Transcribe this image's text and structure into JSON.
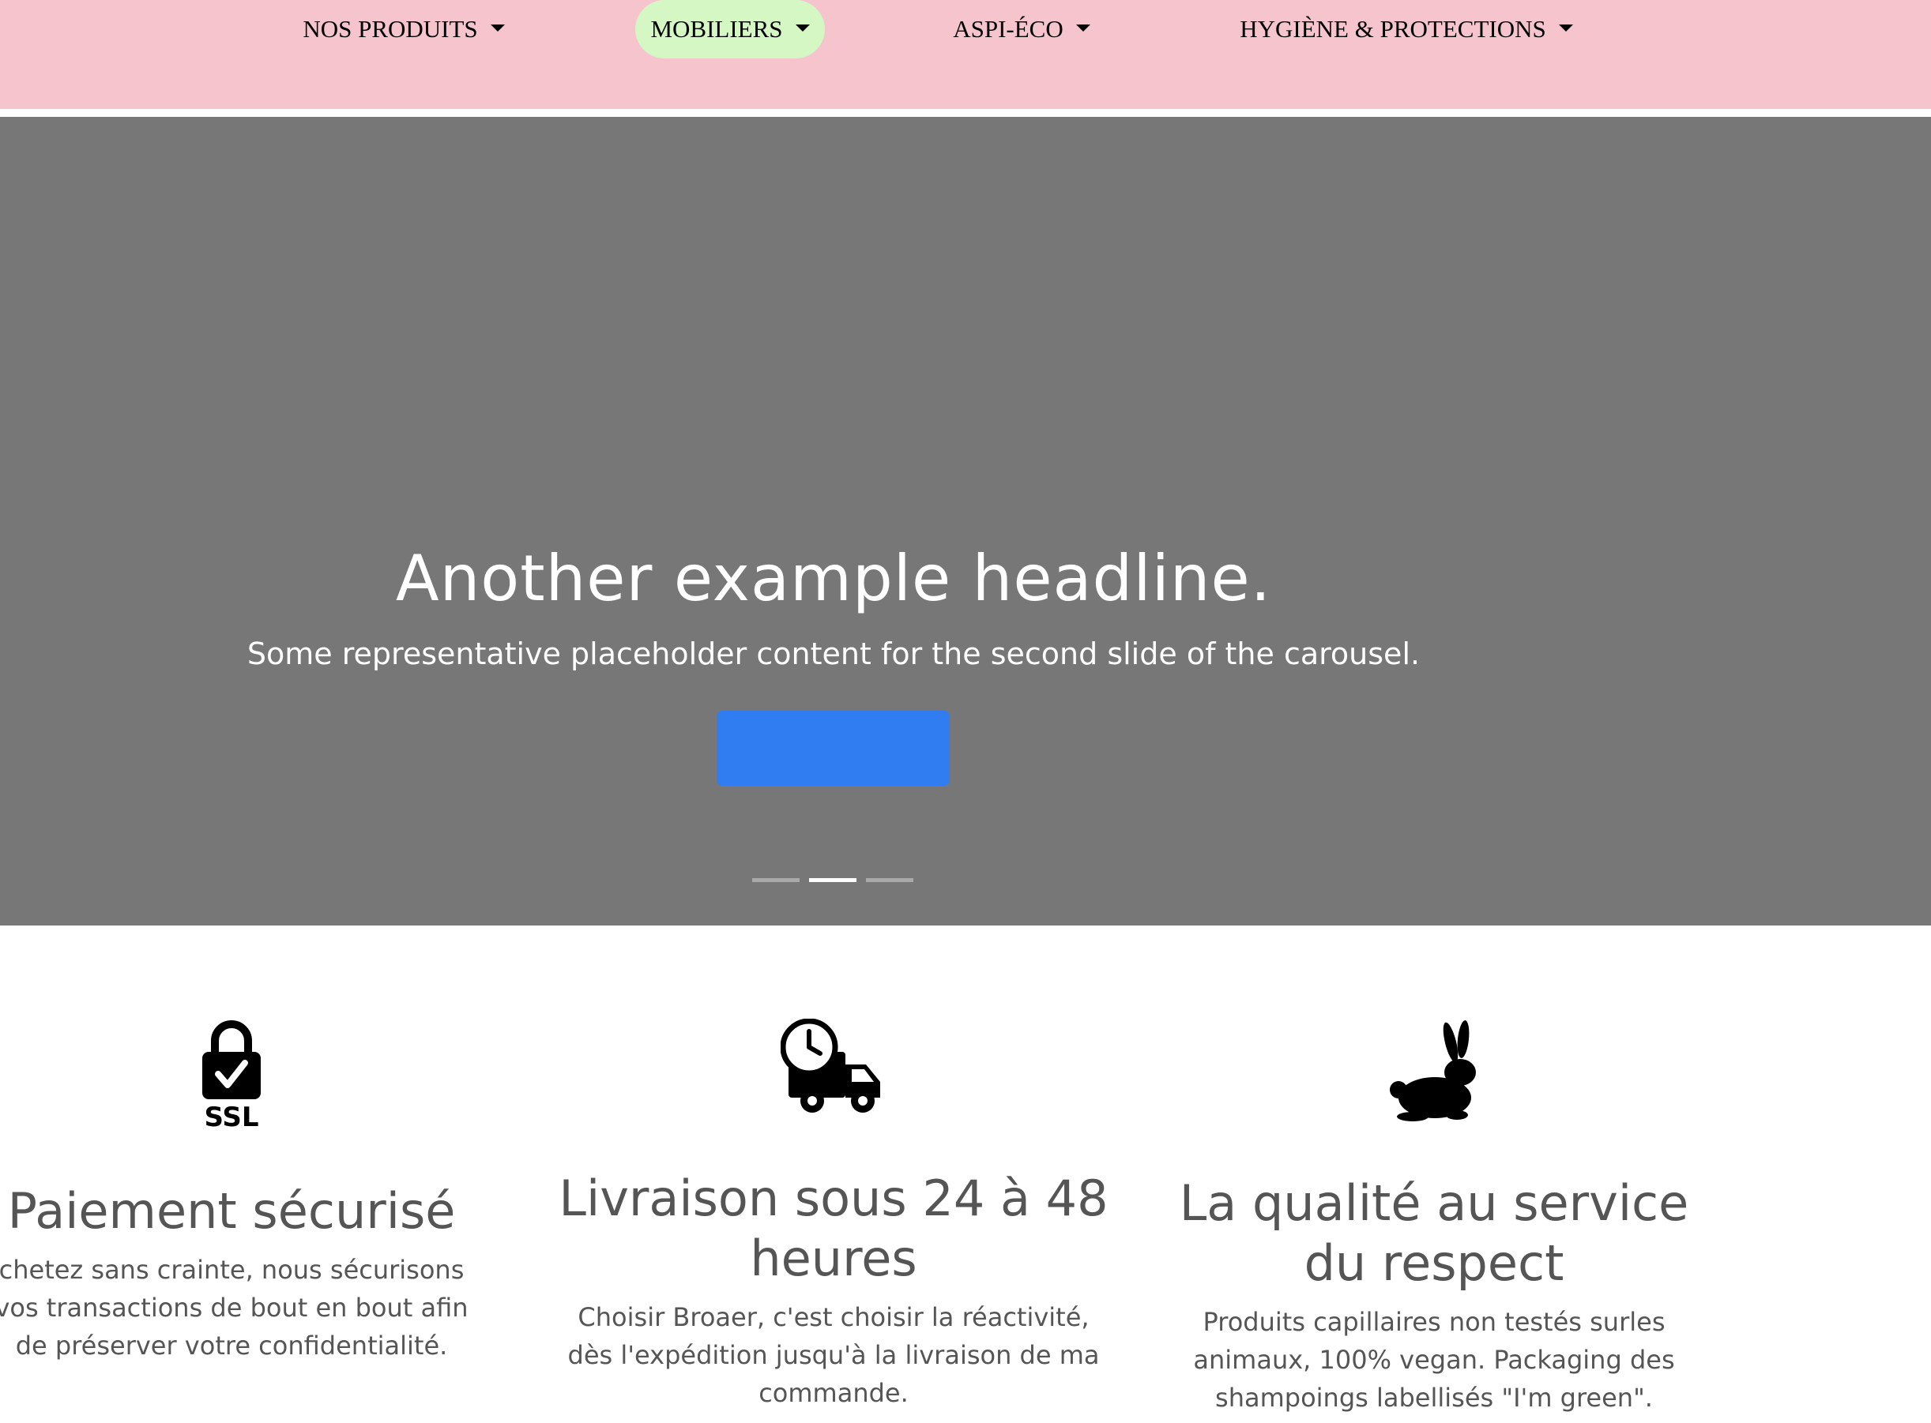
{
  "nav": {
    "items": [
      {
        "label": "NOS PRODUITS"
      },
      {
        "label": "MOBILIERS"
      },
      {
        "label": "ASPI-ÉCO"
      },
      {
        "label": "HYGIÈNE & PROTECTIONS"
      }
    ],
    "active_label": "MOBILIERS"
  },
  "carousel": {
    "headline": "Another example headline.",
    "text": "Some representative placeholder content for the second slide of the carousel.",
    "button_label": "",
    "slide_count": 3,
    "active_slide": 2
  },
  "features": [
    {
      "icon": "ssl-lock-icon",
      "icon_label": "SSL",
      "title": "Paiement sécurisé",
      "text": "chetez sans crainte, nous sécurisons vos transactions de bout en bout afin de préserver votre confidentialité."
    },
    {
      "icon": "delivery-truck-clock-icon",
      "title": "Livraison sous 24 à 48 heures",
      "text": "Choisir Broaer, c'est choisir la réactivité, dès l'expédition jusqu'à la livraison de ma commande."
    },
    {
      "icon": "rabbit-icon",
      "title": "La qualité au service du respect",
      "text": "Produits capillaires non testés surles animaux, 100% vegan. Packaging des shampoings labellisés \"I'm green\"."
    }
  ],
  "colors": {
    "navbar_bg": "#f5c4cd",
    "active_nav_bg": "#d4f7c4",
    "hero_bg": "#777777",
    "button_bg": "#2f7df1",
    "text_gray": "#555555"
  }
}
